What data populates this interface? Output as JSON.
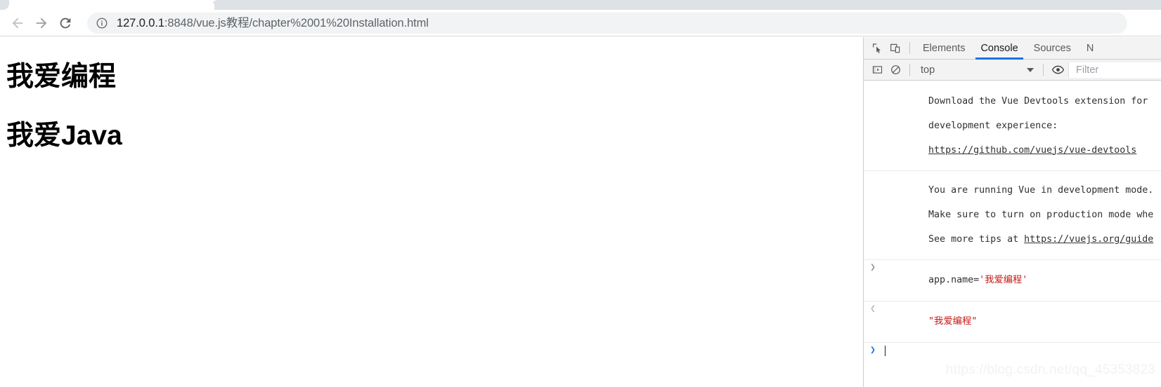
{
  "browser": {
    "nav": {
      "back_label": "Back",
      "forward_label": "Forward",
      "reload_label": "Reload"
    },
    "omnibox": {
      "site_info_label": "View site information",
      "url_host": "127.0.0.1",
      "url_rest": ":8848/vue.js教程/chapter%2001%20Installation.html",
      "url_full": "127.0.0.1:8848/vue.js教程/chapter%2001%20Installation.html"
    }
  },
  "page": {
    "heading1": "我爱编程",
    "heading2": "我爱Java"
  },
  "devtools": {
    "toolbar": {
      "inspect_label": "Inspect element",
      "device_toggle_label": "Toggle device toolbar",
      "more_tabs_label": "N"
    },
    "tabs": [
      {
        "label": "Elements",
        "active": false
      },
      {
        "label": "Console",
        "active": true
      },
      {
        "label": "Sources",
        "active": false
      }
    ],
    "console_toolbar": {
      "sidebar_toggle_label": "Show console sidebar",
      "clear_label": "Clear console",
      "context": "top",
      "live_expression_label": "Create live expression",
      "filter_placeholder": "Filter"
    },
    "messages": [
      {
        "type": "info",
        "lines": [
          "Download the Vue Devtools extension for",
          "development experience:"
        ],
        "link": "https://github.com/vuejs/vue-devtools"
      },
      {
        "type": "info",
        "lines": [
          "You are running Vue in development mode.",
          "Make sure to turn on production mode whe"
        ],
        "line_prefix": "See more tips at ",
        "link": "https://vuejs.org/guide"
      }
    ],
    "input_entry": {
      "chevron": "❯",
      "code_prefix": "app.name=",
      "code_string": "'我爱编程'"
    },
    "result_entry": {
      "chevron": "❮",
      "value": "\"我爱编程\""
    },
    "prompt": {
      "chevron": "❯",
      "value": ""
    }
  },
  "watermark": {
    "text": "https://blog.csdn.net/qq_45353823"
  },
  "colors": {
    "accent_blue": "#1a73e8",
    "console_string_red": "#c41a16",
    "tabstrip_grey": "#dee1e6",
    "omnibox_grey": "#f1f3f4"
  }
}
